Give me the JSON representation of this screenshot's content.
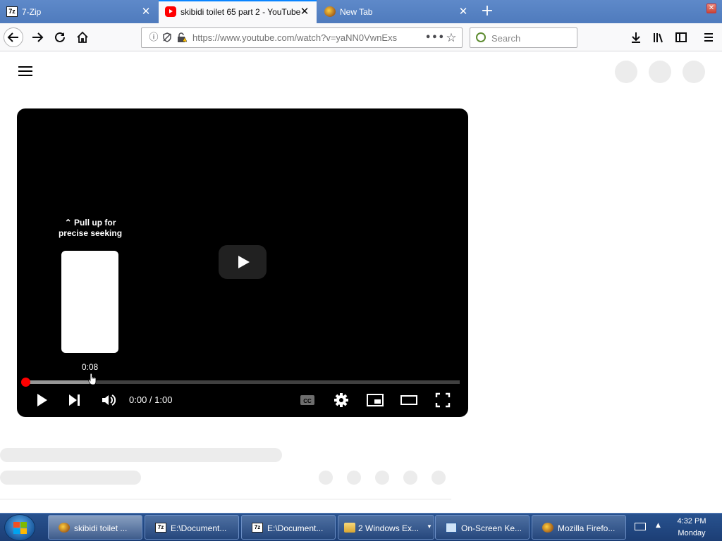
{
  "browser": {
    "tabs": [
      {
        "label": "7-Zip",
        "icon": "7zip-icon"
      },
      {
        "label": "skibidi toilet 65 part 2 - YouTube",
        "icon": "youtube-icon",
        "active": true
      },
      {
        "label": "New Tab",
        "icon": "firefox-icon"
      }
    ],
    "new_tab_label": "+",
    "url": "https://www.youtube.com/watch?v=yaNN0VwnExs",
    "search_placeholder": "Search"
  },
  "player": {
    "pull_up_text": "Pull up for precise seeking",
    "preview_time": "0:08",
    "time_display": "0:00 / 1:00",
    "progress_loaded_fraction": 0.15,
    "progress_played_fraction": 0.0
  },
  "colors": {
    "accent": "#0a84ff",
    "youtube_red": "#ff0000",
    "taskbar": "#28528f"
  },
  "taskbar": {
    "items": [
      {
        "label": "skibidi toilet ...",
        "icon": "firefox-icon",
        "active": true
      },
      {
        "label": "E:\\Document...",
        "icon": "7zip-icon"
      },
      {
        "label": "E:\\Document...",
        "icon": "7zip-icon"
      },
      {
        "label": "2 Windows Ex...",
        "icon": "folder-icon"
      },
      {
        "label": "On-Screen Ke...",
        "icon": "keyboard-icon"
      },
      {
        "label": "Mozilla Firefo...",
        "icon": "firefox-icon"
      }
    ],
    "clock_time": "4:32 PM",
    "clock_day": "Monday"
  }
}
